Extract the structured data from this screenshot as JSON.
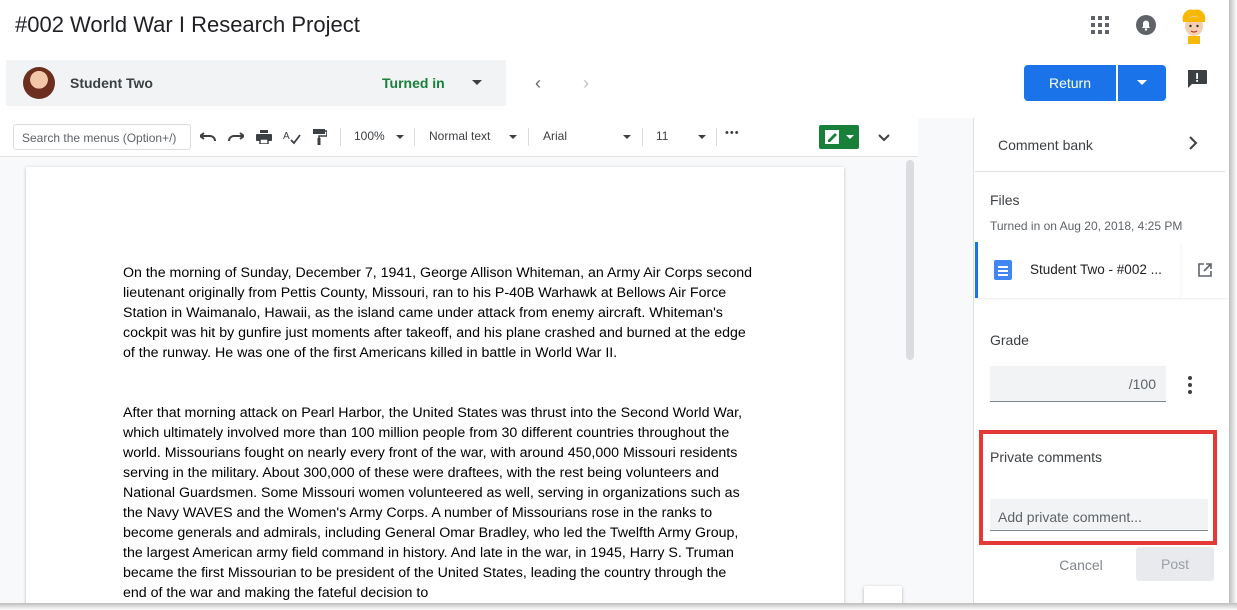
{
  "header": {
    "title": "#002 World War I Research Project"
  },
  "student_bar": {
    "name": "Student Two",
    "status": "Turned in"
  },
  "actions": {
    "return_label": "Return"
  },
  "toolbar": {
    "menu_search_placeholder": "Search the menus (Option+/)",
    "zoom": "100%",
    "style": "Normal text",
    "font": "Arial",
    "font_size": "11",
    "more": "•••"
  },
  "document": {
    "paragraphs": [
      "On the morning of Sunday, December 7, 1941, George Allison Whiteman, an Army Air Corps second lieutenant originally from Pettis County, Missouri, ran to his P-40B Warhawk at Bellows Air Force Station in Waimanalo, Hawaii, as the island came under attack from enemy aircraft. Whiteman's cockpit was hit by gunfire just moments after takeoff, and his plane crashed and burned at the edge of the runway. He was one of the first Americans killed in battle in World War II.",
      "After that morning attack on Pearl Harbor, the United States was thrust into the Second World War, which ultimately involved more than 100 million people from 30 different countries throughout the world. Missourians fought on nearly every front of the war, with around 450,000 Missouri residents serving in the military. About 300,000 of these were draftees, with the rest being volunteers and National Guardsmen. Some Missouri women volunteered as well, serving in organizations such as the Navy WAVES and the Women's Army Corps. A number of Missourians rose in the ranks to become generals and admirals, including General Omar Bradley, who led the Twelfth Army Group, the largest American army field command in history. And late in the war, in 1945, Harry S. Truman became the first Missourian to be president of the United States, leading the country through the end of the war and making the fateful decision to"
    ]
  },
  "panel": {
    "comment_bank": "Comment bank",
    "files_label": "Files",
    "turned_in_time": "Turned in on Aug 20, 2018, 4:25 PM",
    "file_name": "Student Two - #002 ...",
    "grade_label": "Grade",
    "grade_denominator": "/100",
    "private_comments_label": "Private comments",
    "private_comment_placeholder": "Add private comment...",
    "cancel_label": "Cancel",
    "post_label": "Post"
  },
  "colors": {
    "accent": "#1a73e8",
    "status_green": "#188038",
    "highlight_red": "#e53935"
  },
  "icons": [
    "apps-icon",
    "notifications-icon",
    "avatar-icon",
    "chevron-left-icon",
    "chevron-right-icon",
    "feedback-icon",
    "undo-icon",
    "redo-icon",
    "print-icon",
    "spellcheck-icon",
    "paint-format-icon",
    "edit-mode-icon",
    "collapse-icon",
    "chevron-right-icon",
    "doc-icon",
    "open-external-icon",
    "more-vert-icon"
  ]
}
